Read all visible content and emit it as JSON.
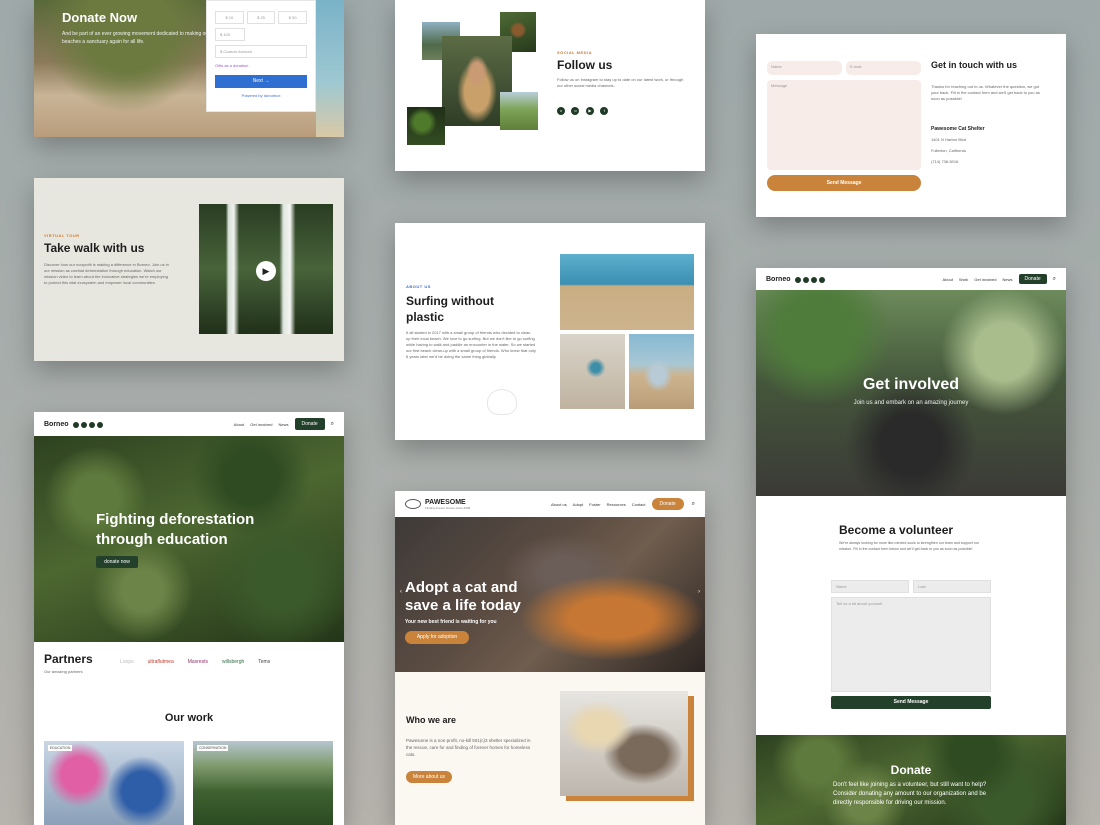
{
  "donate_card": {
    "title": "Donate Now",
    "text": "And be part of an ever growing movement dedicated to making our beaches a sanctuary again for all life.",
    "amounts": [
      "$ 10",
      "$ 25",
      "$ 50",
      "$ 100"
    ],
    "custom_placeholder": "$ Custom Amount",
    "link_text": "Gifts as a donation",
    "next_label": "Next",
    "footer_note": "Powered by donorbox"
  },
  "follow_card": {
    "eyebrow": "SOCIAL MEDIA",
    "title": "Follow us",
    "text": "Follow us on Instagram to stay up to date on our latest work, or through our other social media channels."
  },
  "contact_card": {
    "name_placeholder": "Name",
    "email_placeholder": "E-mail",
    "message_placeholder": "Message",
    "send_label": "Send Message",
    "title": "Get in touch with us",
    "text": "Thanks for reaching out to us. Whatever the question, we got your back. Fill in the contact form and we'll get back to you as soon as possible!",
    "org": "Pawesome Cat Shelter",
    "address1": "1401 N Harbor Blvd",
    "address2": "Fullerton, California",
    "phone": "(714) 738-5016"
  },
  "walk_card": {
    "eyebrow": "VIRTUAL TOUR",
    "title": "Take walk with us",
    "text": "Discover how our nonprofit is making a difference in Borneo. Join us in our mission as combat deforestation through education. Watch our mission video to learn about the innovative strategies we're employing to protect this vital ecosystem and empower local communities."
  },
  "surf_card": {
    "eyebrow": "ABOUT US",
    "title": "Surfing without plastic",
    "text": "It all started in 2017 with a small group of friends who decided to clean up their local beach. We love to go surfing. But we don't like to go surfing while having to walk and paddle an encounter in the water. So we started our first beach clean-up with a small group of friends. Who knew that only 6 years later we'd be doing the same thing globally."
  },
  "borneo_card": {
    "logo": "Borneo",
    "nav": [
      "About",
      "Get involved",
      "News"
    ],
    "donate_label": "Donate",
    "hero_title": "Fighting deforestation through education",
    "hero_button": "donate now",
    "partners_title": "Partners",
    "partners_sub": "Our amazing partners",
    "partners": [
      "Loops",
      "ultraflutmea",
      "Maxrests",
      "willsbergh",
      "Tems"
    ],
    "work_title": "Our work",
    "tag1": "EDUCATION",
    "tag2": "CONSERVATION"
  },
  "pawesome_card": {
    "logo": "PAWESOME",
    "logo_sub": "Finding forever homes since 2005",
    "nav": [
      "About us",
      "Adopt",
      "Foster",
      "Resources",
      "Contact"
    ],
    "donate_label": "Donate",
    "hero_title": "Adopt a cat and save a life today",
    "hero_sub": "Your new best friend is waiting for you",
    "hero_button": "Apply for adoption",
    "who_title": "Who we are",
    "who_text": "Pawesome is a non-profit, no-kill 501(c)3 shelter specialized in the rescue, care for and finding of forever homes for homeless cats.",
    "who_button": "More about us"
  },
  "volunteer_card": {
    "logo": "Borneo",
    "nav": [
      "About",
      "Work",
      "Get involved",
      "News"
    ],
    "donate_label": "Donate",
    "hero_title": "Get involved",
    "hero_sub": "Join us and embark on an amazing journey",
    "form_title": "Become a volunteer",
    "form_text": "We're always looking for more like-minded souls to strengthen our team and support our mission. Fill in the contact form below and we'll get back to you as soon as possible!",
    "name_placeholder": "Name",
    "lastname_placeholder": "Last",
    "about_placeholder": "Tell us a bit about yourself",
    "send_label": "Send Message",
    "donate_title": "Donate",
    "donate_text": "Don't feel like joining as a volunteer, but still want to help? Consider donating any amount to our organization and be directly responsible for driving our mission."
  }
}
